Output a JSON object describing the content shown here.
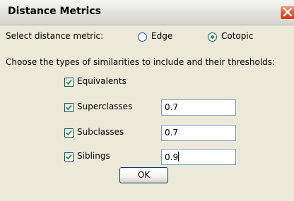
{
  "window": {
    "title": "Distance Metrics"
  },
  "metric": {
    "label": "Select distance metric:",
    "options": [
      {
        "label": "Edge",
        "selected": false
      },
      {
        "label": "Cotopic",
        "selected": true
      }
    ]
  },
  "similarity": {
    "instruction": "Choose the types of similarities to include and their thresholds:",
    "items": [
      {
        "label": "Equivalents",
        "checked": true,
        "threshold": null
      },
      {
        "label": "Superclasses",
        "checked": true,
        "threshold": "0.7"
      },
      {
        "label": "Subclasses",
        "checked": true,
        "threshold": "0.7"
      },
      {
        "label": "Siblings",
        "checked": true,
        "threshold": "0.9"
      }
    ]
  },
  "buttons": {
    "ok_label": "OK"
  },
  "colors": {
    "dialog_background": "#ece9d8",
    "close_button": "#e35a37",
    "radio_dot": "#21a121",
    "check_mark": "#21a121",
    "field_border": "#7f9db9"
  }
}
